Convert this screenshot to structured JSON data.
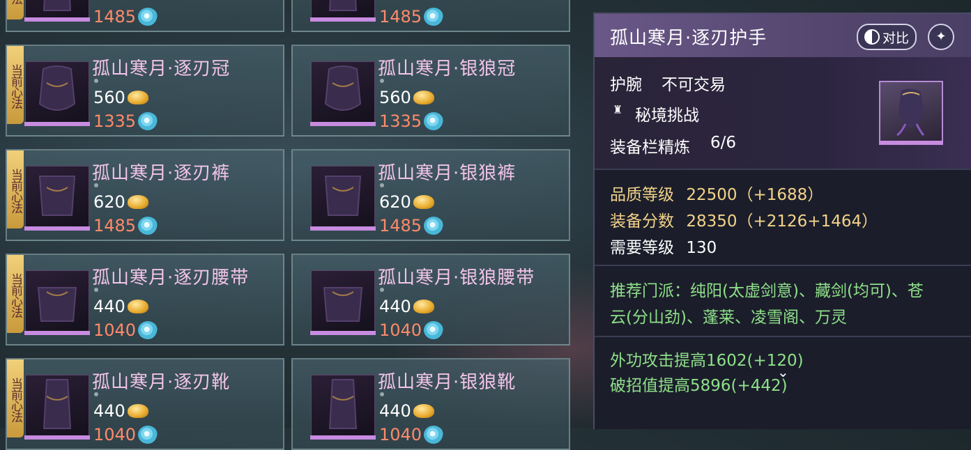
{
  "badge_text": "当前心法",
  "cards_left": [
    {
      "name": "",
      "price_gold": "",
      "price_jade": "1485"
    },
    {
      "name": "孤山寒月·逐刃冠",
      "price_gold": "560",
      "price_jade": "1335"
    },
    {
      "name": "孤山寒月·逐刃裤",
      "price_gold": "620",
      "price_jade": "1485"
    },
    {
      "name": "孤山寒月·逐刃腰带",
      "price_gold": "440",
      "price_jade": "1040"
    },
    {
      "name": "孤山寒月·逐刃靴",
      "price_gold": "440",
      "price_jade": "1040"
    }
  ],
  "cards_right": [
    {
      "name": "",
      "price_gold": "",
      "price_jade": "1485"
    },
    {
      "name": "孤山寒月·银狼冠",
      "price_gold": "560",
      "price_jade": "1335"
    },
    {
      "name": "孤山寒月·银狼裤",
      "price_gold": "620",
      "price_jade": "1485"
    },
    {
      "name": "孤山寒月·银狼腰带",
      "price_gold": "440",
      "price_jade": "1040"
    },
    {
      "name": "孤山寒月·银狼靴",
      "price_gold": "440",
      "price_jade": "1040"
    }
  ],
  "detail": {
    "title": "孤山寒月·逐刃护手",
    "compare_label": "对比",
    "slot": "护腕",
    "trade": "不可交易",
    "source": "秘境挑战",
    "refine_label": "装备栏精炼",
    "refine_value": "6/6",
    "quality_label": "品质等级",
    "quality_value": "22500（+1688）",
    "score_label": "装备分数",
    "score_value": "28350（+2126+1464）",
    "level_label": "需要等级",
    "level_value": "130",
    "recommend_line1": "推荐门派：纯阳(太虚剑意)、藏剑(均可)、苍",
    "recommend_line2": "云(分山劲)、蓬莱、凌雪阁、万灵",
    "attr1": "外功攻击提高1602(+120)",
    "attr2": "破招值提高5896(+442)"
  }
}
